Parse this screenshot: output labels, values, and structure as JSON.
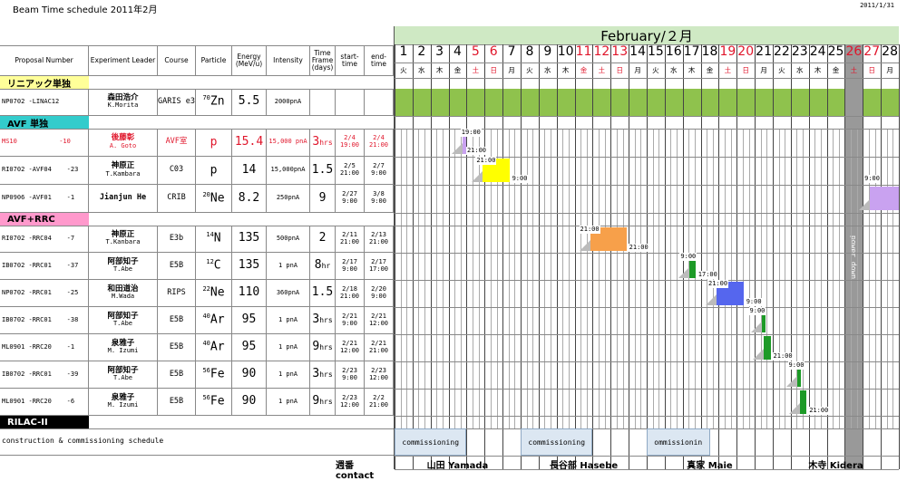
{
  "page": {
    "title": "Beam Time schedule  2011年2月",
    "date": "2011/1/31",
    "month_header": "February/２月"
  },
  "headers": {
    "proposal": "Proposal Number",
    "leader": "Experiment Leader",
    "course": "Course",
    "particle": "Particle",
    "energy": "Energy (MeV/u)",
    "intensity": "Intensity",
    "timeframe": "Time Frame (days)",
    "start": "start-time",
    "end": "end-time"
  },
  "sections": {
    "linac": "リニアック単独",
    "avf": "AVF 単独",
    "avfrrc": "AVF+RRC",
    "rilac": "RILAC-II"
  },
  "colors": {
    "linac": "#ffff99",
    "avf": "#33cccc",
    "avfrrc": "#ff99cc",
    "rilac": "#000000",
    "green": "#8fc24d",
    "shutdown": "#999999"
  },
  "days": [
    "1",
    "2",
    "3",
    "4",
    "5",
    "6",
    "7",
    "8",
    "9",
    "10",
    "11",
    "12",
    "13",
    "14",
    "15",
    "16",
    "17",
    "18",
    "19",
    "20",
    "21",
    "22",
    "23",
    "24",
    "25",
    "26",
    "27",
    "28"
  ],
  "weekdays": [
    "火",
    "水",
    "木",
    "金",
    "土",
    "日",
    "月",
    "火",
    "水",
    "木",
    "金",
    "土",
    "日",
    "月",
    "火",
    "水",
    "木",
    "金",
    "土",
    "日",
    "月",
    "火",
    "水",
    "木",
    "金",
    "土",
    "日",
    "月"
  ],
  "red_days": [
    5,
    6,
    11,
    12,
    13,
    19,
    20,
    26,
    27
  ],
  "rows": [
    {
      "proposal": "NP0702 -LINAC12",
      "leader": "森田浩介",
      "leader_en": "K.Morita",
      "course": "GARIS e3",
      "mass": "70",
      "elem": "Zn",
      "energy": "5.5",
      "intensity": "2000pnA",
      "tf": "",
      "tf_unit": "",
      "start1": "",
      "start2": "",
      "end1": "",
      "end2": "",
      "red": false
    },
    {
      "proposal": "MS10           -10",
      "leader": "後藤彰",
      "leader_en": "A. Goto",
      "course": "AVF室",
      "mass": "",
      "elem": "p",
      "energy": "15.4",
      "intensity": "15,000 pnA",
      "tf": "3",
      "tf_unit": "hrs",
      "start1": "2/4",
      "start2": "19:00",
      "end1": "2/4",
      "end2": "21:00",
      "red": true
    },
    {
      "proposal": "RI0702 -AVF04    -23",
      "leader": "神原正",
      "leader_en": "T.Kambara",
      "course": "C03",
      "mass": "",
      "elem": "p",
      "energy": "14",
      "intensity": "15,000pnA",
      "tf": "1.5",
      "tf_unit": "",
      "start1": "2/5",
      "start2": "21:00",
      "end1": "2/7",
      "end2": "9:00",
      "red": false
    },
    {
      "proposal": "NP0906 -AVF01    -1",
      "leader": "Jianjun He",
      "leader_en": "",
      "course": "CRIB",
      "mass": "20",
      "elem": "Ne",
      "energy": "8.2",
      "intensity": "250pnA",
      "tf": "9",
      "tf_unit": "",
      "start1": "2/27",
      "start2": "9:00",
      "end1": "3/8",
      "end2": "9:00",
      "red": false
    },
    {
      "proposal": "RI0702 -RRC04    -7",
      "leader": "神原正",
      "leader_en": "T.Kanbara",
      "course": "E3b",
      "mass": "14",
      "elem": "N",
      "energy": "135",
      "intensity": "500pnA",
      "tf": "2",
      "tf_unit": "",
      "start1": "2/11",
      "start2": "21:00",
      "end1": "2/13",
      "end2": "21:00",
      "red": false
    },
    {
      "proposal": "IB0702 -RRC01    -37",
      "leader": "阿部知子",
      "leader_en": "T.Abe",
      "course": "E5B",
      "mass": "12",
      "elem": "C",
      "energy": "135",
      "intensity": "1 pnA",
      "tf": "8",
      "tf_unit": "hr",
      "start1": "2/17",
      "start2": "9:00",
      "end1": "2/17",
      "end2": "17:00",
      "red": false
    },
    {
      "proposal": "NP0702 -RRC01    -25",
      "leader": "和田道治",
      "leader_en": "M.Wada",
      "course": "RIPS",
      "mass": "22",
      "elem": "Ne",
      "energy": "110",
      "intensity": "360pnA",
      "tf": "1.5",
      "tf_unit": "",
      "start1": "2/18",
      "start2": "21:00",
      "end1": "2/20",
      "end2": "9:00",
      "red": false
    },
    {
      "proposal": "IB0702 -RRC01    -38",
      "leader": "阿部知子",
      "leader_en": "T.Abe",
      "course": "E5B",
      "mass": "40",
      "elem": "Ar",
      "energy": "95",
      "intensity": "1 pnA",
      "tf": "3",
      "tf_unit": "hrs",
      "start1": "2/21",
      "start2": "9:00",
      "end1": "2/21",
      "end2": "12:00",
      "red": false
    },
    {
      "proposal": "ML0901 -RRC20    -1",
      "leader": "泉雅子",
      "leader_en": "M. Izumi",
      "course": "E5B",
      "mass": "40",
      "elem": "Ar",
      "energy": "95",
      "intensity": "1 pnA",
      "tf": "9",
      "tf_unit": "hrs",
      "start1": "2/21",
      "start2": "12:00",
      "end1": "2/21",
      "end2": "21:00",
      "red": false
    },
    {
      "proposal": "IB0702 -RRC01    -39",
      "leader": "阿部知子",
      "leader_en": "T.Abe",
      "course": "E5B",
      "mass": "56",
      "elem": "Fe",
      "energy": "90",
      "intensity": "1 pnA",
      "tf": "3",
      "tf_unit": "hrs",
      "start1": "2/23",
      "start2": "9:00",
      "end1": "2/23",
      "end2": "12:00",
      "red": false
    },
    {
      "proposal": "ML0901 -RRC20    -6",
      "leader": "泉雅子",
      "leader_en": "M. Izumi",
      "course": "E5B",
      "mass": "56",
      "elem": "Fe",
      "energy": "90",
      "intensity": "1 pnA",
      "tf": "9",
      "tf_unit": "hrs",
      "start1": "2/23",
      "start2": "12:00",
      "end1": "2/2",
      "end2": "21:00",
      "red": false
    }
  ],
  "construction": "construction & commissioning schedule",
  "commissioning": [
    "commissioning",
    "commissioning",
    "ommissionin"
  ],
  "contact_label": "週番 contact",
  "contacts": [
    "山田 Yamada",
    "長谷部 Hasebe",
    "真家 Maie",
    "木寺 Kidera"
  ],
  "power_down": "power down",
  "bar_times": {
    "r1a": "19:00",
    "r1b": "21:00",
    "r2a": "21:00",
    "r2b": "9:00",
    "r3a": "9:00",
    "r4a": "21:00",
    "r4b": "21:00",
    "r5a": "9:00",
    "r5b": "17:00",
    "r6a": "21:00",
    "r6b": "9:00",
    "r7a": "9:00",
    "r8b": "21:00",
    "r9a": "9:00",
    "r10b": "21:00"
  }
}
